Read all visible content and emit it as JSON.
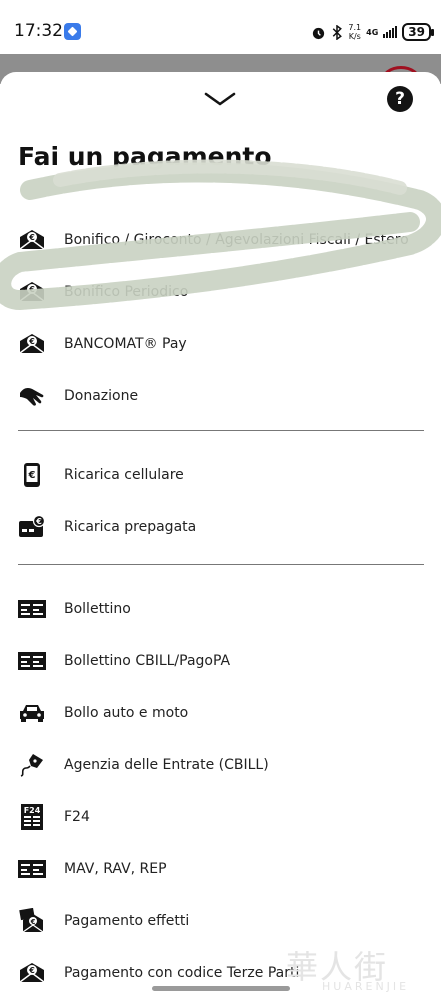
{
  "status_bar": {
    "time": "17:32",
    "net_speed_value": "7.1",
    "net_speed_unit": "K/s",
    "network": "4G",
    "battery": "39"
  },
  "sheet": {
    "title": "Fai un pagamento",
    "help_label": "?"
  },
  "groups": [
    {
      "items": [
        {
          "label": "Bonifico / Giroconto / Agevolazioni Fiscali / Estero",
          "icon": "euro-envelope-icon"
        },
        {
          "label": "Bonifico Periodico",
          "icon": "euro-envelope-icon"
        },
        {
          "label": "BANCOMAT® Pay",
          "icon": "euro-envelope-icon"
        },
        {
          "label": "Donazione",
          "icon": "giving-hand-icon"
        }
      ]
    },
    {
      "items": [
        {
          "label": "Ricarica cellulare",
          "icon": "phone-euro-icon"
        },
        {
          "label": "Ricarica prepagata",
          "icon": "card-euro-icon"
        }
      ]
    },
    {
      "items": [
        {
          "label": "Bollettino",
          "icon": "bill-icon"
        },
        {
          "label": "Bollettino CBILL/PagoPA",
          "icon": "bill-icon"
        },
        {
          "label": "Bollo auto e moto",
          "icon": "car-icon"
        },
        {
          "label": "Agenzia delle Entrate (CBILL)",
          "icon": "pen-nib-icon"
        },
        {
          "label": "F24",
          "icon": "f24-form-icon"
        },
        {
          "label": "MAV, RAV, REP",
          "icon": "bill-icon"
        },
        {
          "label": "Pagamento effetti",
          "icon": "bill-stack-icon"
        },
        {
          "label": "Pagamento con codice Terze Parti",
          "icon": "euro-envelope-icon"
        }
      ]
    }
  ],
  "watermark": {
    "chinese": "華人街",
    "latin": "HUARENJIE"
  },
  "colors": {
    "sheet_bg": "#ffffff",
    "icon": "#141414",
    "divider": "#777777",
    "backdrop": "#8e8e8e",
    "accent_red": "#a01020"
  }
}
